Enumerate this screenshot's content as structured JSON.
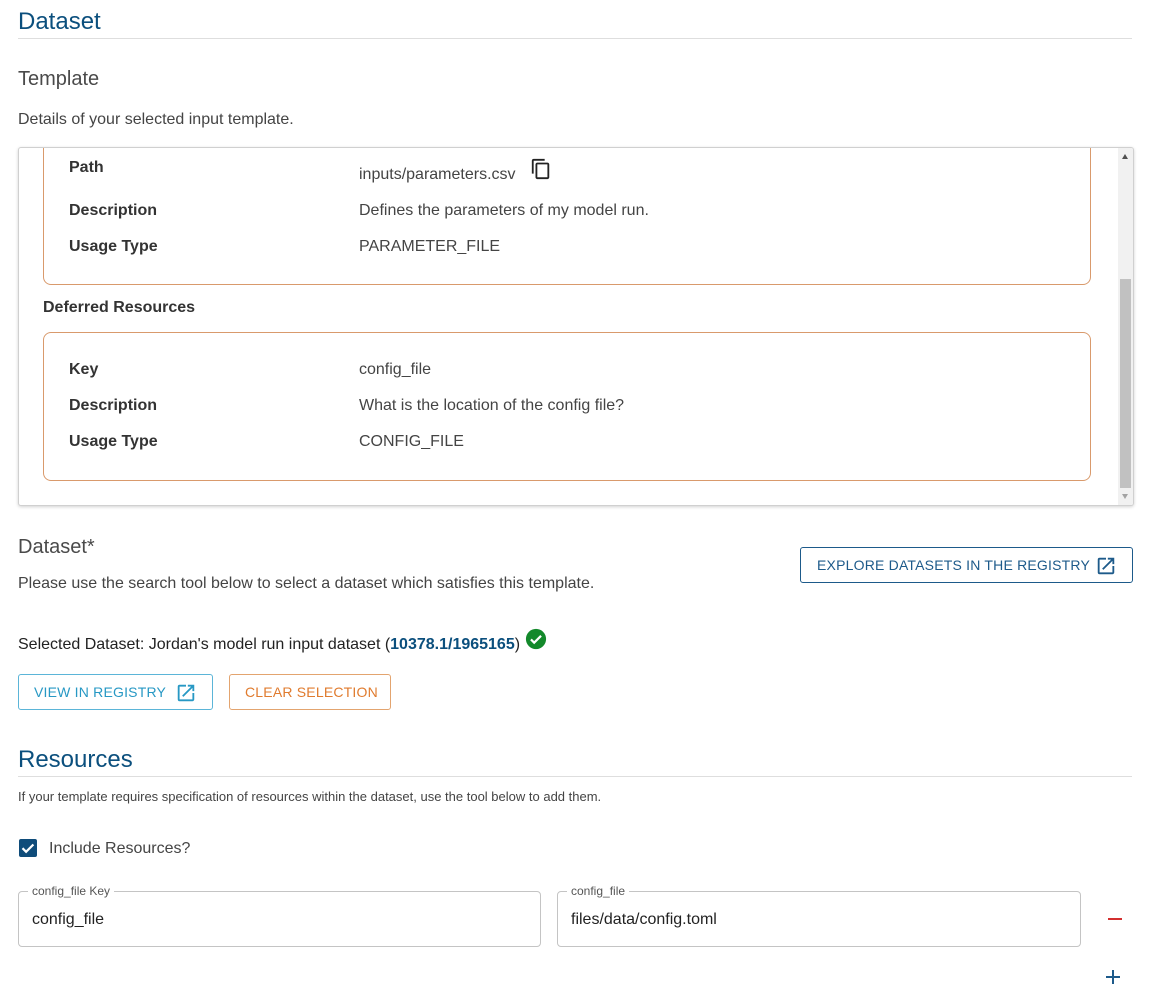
{
  "dataset_heading": "Dataset",
  "template": {
    "heading": "Template",
    "description": "Details of your selected input template.",
    "resource": {
      "path_label": "Path",
      "path_value": "inputs/parameters.csv",
      "description_label": "Description",
      "description_value": "Defines the parameters of my model run.",
      "usage_label": "Usage Type",
      "usage_value": "PARAMETER_FILE"
    },
    "deferred_heading": "Deferred Resources",
    "deferred": {
      "key_label": "Key",
      "key_value": "config_file",
      "description_label": "Description",
      "description_value": "What is the location of the config file?",
      "usage_label": "Usage Type",
      "usage_value": "CONFIG_FILE"
    }
  },
  "dataset": {
    "heading": "Dataset*",
    "instructions": "Please use the search tool below to select a dataset which satisfies this template.",
    "explore_button": "EXPLORE DATASETS IN THE REGISTRY",
    "selected_prefix": "Selected Dataset: Jordan's model run input dataset (",
    "selected_id": "10378.1/1965165",
    "selected_suffix": ")",
    "view_button": "VIEW IN REGISTRY",
    "clear_button": "CLEAR SELECTION"
  },
  "resources": {
    "heading": "Resources",
    "description": "If your template requires specification of resources within the dataset, use the tool below to add them.",
    "include_label": "Include Resources?",
    "include_checked": true,
    "key_field_label": "config_file Key",
    "key_field_value": "config_file",
    "path_field_label": "config_file",
    "path_field_value": "files/data/config.toml"
  },
  "colors": {
    "heading": "#0b4f7d",
    "primary": "#1d5a8a",
    "info": "#2798c4",
    "warning": "#e07b2e",
    "success": "#13892b",
    "error": "#d32f2f"
  },
  "icons": [
    "copy-icon",
    "external-link-icon",
    "check-circle-icon",
    "remove-icon",
    "add-icon"
  ]
}
